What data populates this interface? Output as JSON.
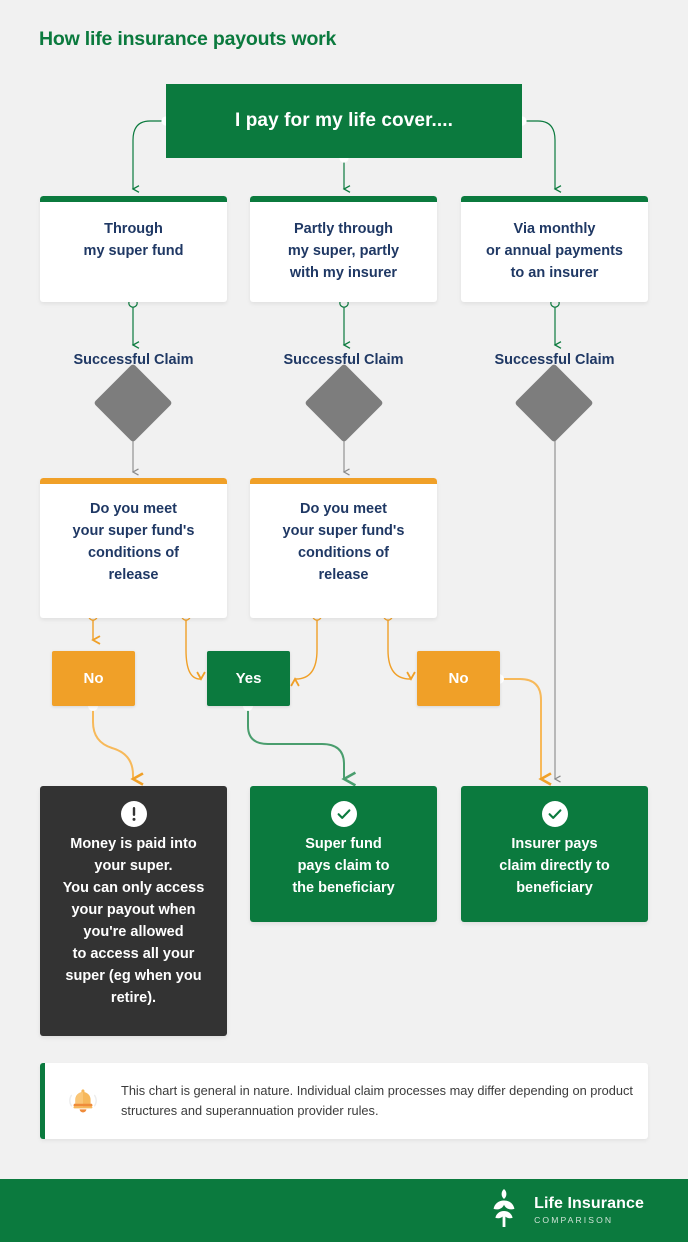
{
  "page": {
    "title": "How life insurance payouts work",
    "background": "#f1f1f1"
  },
  "colors": {
    "green": "#0b7a3e",
    "orange": "#f0a028",
    "navy": "#1f3864",
    "grey_diamond": "#7d7d7d",
    "dark_box": "#333333"
  },
  "flow": {
    "hero": {
      "label": "I pay for my life cover...."
    },
    "tier2": [
      {
        "id": "through-super",
        "label": "Through\nmy super fund",
        "accent": "#0b7a3e"
      },
      {
        "id": "partly-super",
        "label": "Partly through\nmy super, partly\nwith my insurer",
        "accent": "#0b7a3e"
      },
      {
        "id": "direct-insurer",
        "label": "Via monthly\nor annual payments\nto an insurer",
        "accent": "#0b7a3e"
      }
    ],
    "claim_labels": [
      {
        "label": "Successful Claim"
      },
      {
        "label": "Successful Claim"
      },
      {
        "label": "Successful Claim"
      }
    ],
    "decisions": [
      {
        "id": "conditions-1",
        "label": "Do you meet\nyour super fund's\nconditions of\nrelease",
        "accent": "#f0a028"
      },
      {
        "id": "conditions-2",
        "label": "Do you meet\nyour super fund's\nconditions of\nrelease",
        "accent": "#f0a028"
      }
    ],
    "answers": [
      {
        "id": "no-1",
        "label": "No",
        "type": "no"
      },
      {
        "id": "yes",
        "label": "Yes",
        "type": "yes"
      },
      {
        "id": "no-2",
        "label": "No",
        "type": "no"
      }
    ],
    "results": [
      {
        "id": "paid-into-super",
        "icon": "alert-icon",
        "label": "Money is paid into\nyour super.\nYou can only access\nyour payout when\nyou're allowed\nto access all your\nsuper (eg when you\nretire).",
        "style": "dark"
      },
      {
        "id": "super-fund-pays",
        "icon": "check-icon",
        "label": "Super fund\npays claim to\nthe beneficiary",
        "style": "green"
      },
      {
        "id": "insurer-pays",
        "icon": "check-icon",
        "label": "Insurer pays\nclaim directly to\nbeneficiary",
        "style": "green"
      }
    ]
  },
  "disclaimer": {
    "icon": "bell-icon",
    "text": "This chart is general in nature. Individual claim processes may differ depending on product structures and superannuation provider rules."
  },
  "footer": {
    "logo_icon": "tree-logo-icon",
    "brand_line1": "Life Insurance",
    "brand_line2": "COMPARISON"
  }
}
